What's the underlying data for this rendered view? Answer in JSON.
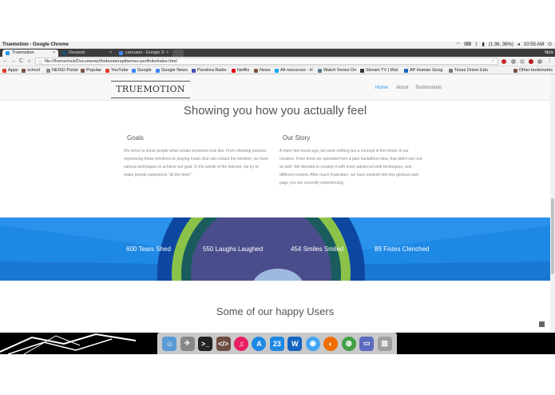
{
  "os": {
    "window_title": "Truemotion - Google Chrome",
    "tray": {
      "battery": "(1:36, 36%)",
      "time": "10:55 AM"
    }
  },
  "tabs": [
    {
      "label": "Truemotion",
      "close": "×",
      "color": "#2196f3"
    },
    {
      "label": "Devpost",
      "close": "×",
      "color": "#1a5276"
    },
    {
      "label": "carousel - Google S",
      "close": "×",
      "color": "#4285f4"
    }
  ],
  "user": "Nick",
  "toolbar": {
    "back": "←",
    "forward": "→",
    "reload": "C",
    "home": "⌂",
    "url": "file:///home/nick/Documents/thebootstrapthemes-portfolio/index.html",
    "star": "☆"
  },
  "bookmarks": [
    {
      "label": "Apps",
      "color": "#e53935"
    },
    {
      "label": "school",
      "color": "#555"
    },
    {
      "label": "NEISD Portal",
      "color": "#888"
    },
    {
      "label": "Popular",
      "color": "#555"
    },
    {
      "label": "YouTube",
      "color": "#e53935"
    },
    {
      "label": "Google",
      "color": "#4285f4"
    },
    {
      "label": "Google News",
      "color": "#4285f4"
    },
    {
      "label": "Pandora Radio",
      "color": "#3f51b5"
    },
    {
      "label": "Netflix",
      "color": "#e50914"
    },
    {
      "label": "News",
      "color": "#555"
    },
    {
      "label": "All resources - H",
      "color": "#03a9f4"
    },
    {
      "label": "Watch Series On",
      "color": "#607d8b"
    },
    {
      "label": "Stream TV | Wat",
      "color": "#333"
    },
    {
      "label": "AP Human Geog",
      "color": "#1565c0"
    },
    {
      "label": "Texas Driver Edu",
      "color": "#777"
    }
  ],
  "other_bookmarks": "Other bookmarks",
  "site": {
    "brand": "TRUEMOTION",
    "nav": [
      {
        "label": "Home",
        "active": true
      },
      {
        "label": "About",
        "active": false
      },
      {
        "label": "Testimonials",
        "active": false
      }
    ],
    "hero_title": "Showing you how you actually feel",
    "goals": {
      "title": "Goals",
      "text": "We strive to show people what certain emotions look like. From showing pictures expressing those emotions to playing music that can extract the emotion, we have various techniques to achieve our goal. In the words of the internet, we try to make people experience \"all the feels\"."
    },
    "story": {
      "title": "Our Story",
      "text": "A mere few hours ago, we were nothing but a concept in the minds of our creators. From there we sprouted from a past hackathon idea, that didn't turn out so well. We decided to revamp it with more advanced web techniques, and different content. After much frustration, we have evolved into this glorious web page you are currently experiencing."
    },
    "stats": [
      "600 Tears Shed",
      "550 Laughs Laughed",
      "454 Smiles Smiled",
      "89 Fistes Clenched"
    ],
    "users_title": "Some of our happy Users"
  },
  "dock": [
    {
      "name": "finder",
      "color": "#5b9bd5",
      "glyph": "☺"
    },
    {
      "name": "launchpad",
      "color": "#888",
      "glyph": "✈"
    },
    {
      "name": "terminal",
      "color": "#222",
      "glyph": ">_"
    },
    {
      "name": "code-editor",
      "color": "#6d4c41",
      "glyph": "</>"
    },
    {
      "name": "music",
      "color": "#e91e63",
      "glyph": "♫"
    },
    {
      "name": "app-store",
      "color": "#1e88e5",
      "glyph": "A"
    },
    {
      "name": "calendar",
      "color": "#1e88e5",
      "glyph": "23"
    },
    {
      "name": "word",
      "color": "#1565c0",
      "glyph": "W"
    },
    {
      "name": "network",
      "color": "#42a5f5",
      "glyph": "◉"
    },
    {
      "name": "firefox",
      "color": "#ef6c00",
      "glyph": "◐"
    },
    {
      "name": "chrome",
      "color": "#43a047",
      "glyph": "◍"
    },
    {
      "name": "display",
      "color": "#5c6bc0",
      "glyph": "▭"
    },
    {
      "name": "trash",
      "color": "#9e9e9e",
      "glyph": "▥"
    }
  ]
}
